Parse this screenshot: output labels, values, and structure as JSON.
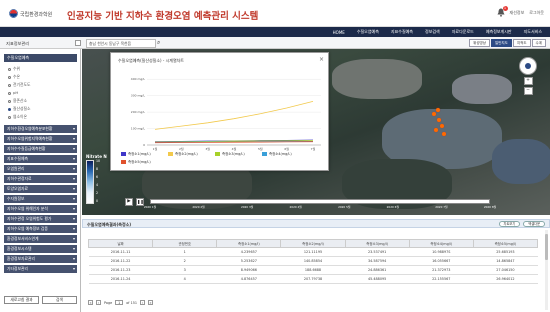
{
  "header": {
    "org_name": "국립환경과학원",
    "app_title": "인공지능 기반 지하수 환경오염 예측관리 시스템",
    "notifications": "1",
    "user_name": "재선정보",
    "logout": "로그아웃"
  },
  "topnav": {
    "items": [
      "HOME",
      "수질오염예측",
      "지표수질예측",
      "정보검색",
      "자료다운로드",
      "예측정보게시판",
      "지도서비스"
    ]
  },
  "subbar": {
    "sidebar_heading": "지표정보관리",
    "search_placeholder": "충남 천안시 동남구 목천읍",
    "view_tabs": [
      "위성영상",
      "일반지도",
      "지적도",
      "수계"
    ]
  },
  "sidebar": {
    "group_title": "수질오염예측",
    "radios": [
      {
        "label": "수위",
        "selected": false
      },
      {
        "label": "수온",
        "selected": false
      },
      {
        "label": "전기전도도",
        "selected": false
      },
      {
        "label": "pH",
        "selected": false
      },
      {
        "label": "용존산소",
        "selected": false
      },
      {
        "label": "질산성질소",
        "selected": true
      },
      {
        "label": "염소이온",
        "selected": false
      }
    ],
    "items": [
      "지하수환경오염예측분포현황",
      "지하수오염위험지역예측현황",
      "지하수수질등급예측현황",
      "지표수질예측",
      "오염원관리",
      "지하수관정자료",
      "토양오염자료",
      "수자원정보",
      "지하수오염 위해인자 분석",
      "지하수관정 오염위험도 평가",
      "지하수오염 예측정보 검증",
      "환경정보서비스연계",
      "환경정보시스템",
      "환경정보자료관리",
      "기타정보관리"
    ],
    "btn_reset": "새로고침 결과",
    "btn_search": "검색"
  },
  "map": {
    "legend_title": "Nitrate N",
    "legend_labels": [
      "10",
      "8",
      "6",
      "4",
      "2",
      "0"
    ],
    "play": "▶",
    "pause": "❚❚",
    "timeline_progress": 1.0,
    "timeline_ticks": [
      "2020\n1월",
      "2020\n2월",
      "2020\n3월",
      "2020\n4월",
      "2020\n5월",
      "2020\n6월",
      "2020\n7월",
      "2020\n8월"
    ],
    "zoom_in": "+",
    "zoom_out": "−"
  },
  "chart_popup": {
    "title": "수질오염예측(질산성질소) - 시계열차트",
    "close": "×"
  },
  "chart_data": {
    "type": "line",
    "categories": [
      "1월",
      "2월",
      "3월",
      "4월",
      "5월",
      "6월",
      "7월"
    ],
    "ylim": [
      0,
      450
    ],
    "y_ticks": [
      0,
      100,
      200,
      300,
      400
    ],
    "y_tick_labels": [
      "0",
      "100 mg/L",
      "200 mg/L",
      "300 mg/L",
      "400 mg/L"
    ],
    "series": [
      {
        "name": "측정소1(mg/L)",
        "color": "#3f37c9",
        "values": [
          20,
          22,
          24,
          25,
          27,
          28,
          30
        ]
      },
      {
        "name": "측정소2(mg/L)",
        "color": "#f2c94c",
        "values": [
          95,
          115,
          135,
          160,
          190,
          225,
          265
        ]
      },
      {
        "name": "측정소3(mg/L)",
        "color": "#a7d129",
        "values": [
          18,
          20,
          22,
          24,
          25,
          26,
          28
        ]
      },
      {
        "name": "측정소4(mg/L)",
        "color": "#3aa0d9",
        "values": [
          16,
          17,
          18,
          19,
          20,
          21,
          22
        ]
      },
      {
        "name": "측정소5(mg/L)",
        "color": "#e0522d",
        "values": [
          14,
          15,
          16,
          17,
          18,
          19,
          20
        ]
      }
    ],
    "grid": true
  },
  "panel": {
    "title": "수질오염예측결과(측정소)",
    "btn_chart": "차트보기",
    "btn_excel": "엑셀다운",
    "columns": [
      "날짜",
      "관정번호",
      "측정소1(mg/l)",
      "측정소2(mg/l)",
      "측정소3(mg/l)",
      "측정소4(mg/l)",
      "측정소5(mg/l)"
    ],
    "rows": [
      [
        "2016-11-11",
        "1",
        "4.239657",
        "121.11195",
        "23.537491",
        "10.98897S",
        "25.685193"
      ],
      [
        "2016-11-22",
        "2",
        "5.253627",
        "140.85854",
        "34.587594",
        "16.055667",
        "14.865847"
      ],
      [
        "2016-11-23",
        "3",
        "8.949066",
        "188.6688",
        "24.886361",
        "21.372973",
        "27.046150"
      ],
      [
        "2016-11-24",
        "4",
        "4.876457",
        "207.79738",
        "45.488095",
        "22.155567",
        "26.964012"
      ]
    ],
    "pager": {
      "page_label": "Page",
      "page": "1",
      "of_label": "of 151"
    }
  }
}
